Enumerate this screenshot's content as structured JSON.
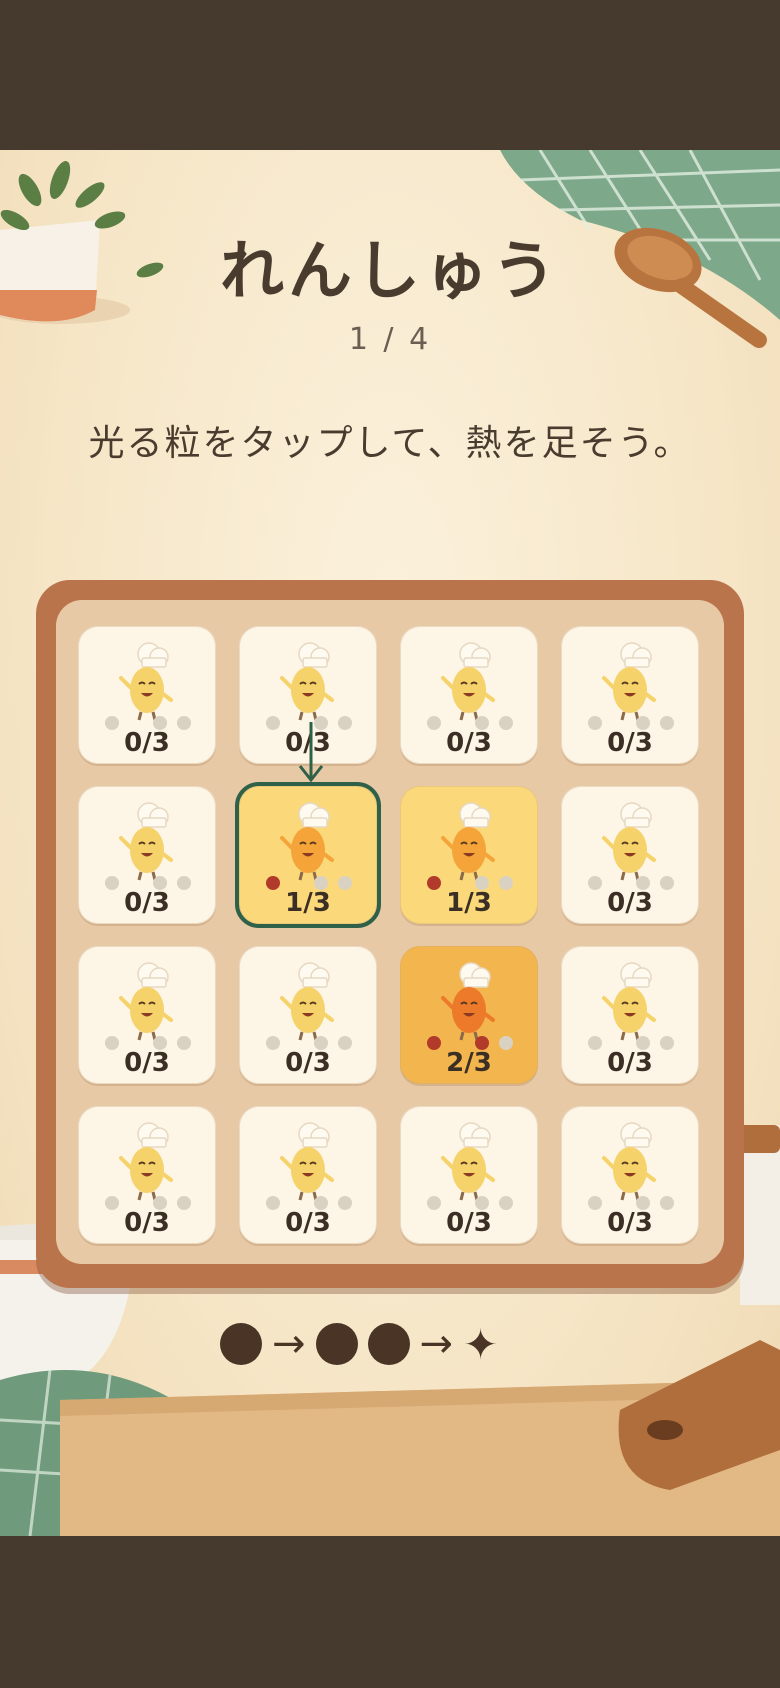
{
  "screen": {
    "title": "れんしゅう",
    "progress": "1 / 4",
    "instruction": "光る粒をタップして、熱を足そう。"
  },
  "grid": {
    "rows": 4,
    "cols": 4,
    "selected_index": 5,
    "tiles": [
      {
        "count": "0/3",
        "level": 0
      },
      {
        "count": "0/3",
        "level": 0
      },
      {
        "count": "0/3",
        "level": 0
      },
      {
        "count": "0/3",
        "level": 0
      },
      {
        "count": "0/3",
        "level": 0
      },
      {
        "count": "1/3",
        "level": 1
      },
      {
        "count": "1/3",
        "level": 1
      },
      {
        "count": "0/3",
        "level": 0
      },
      {
        "count": "0/3",
        "level": 0
      },
      {
        "count": "0/3",
        "level": 0
      },
      {
        "count": "2/3",
        "level": 2
      },
      {
        "count": "0/3",
        "level": 0
      },
      {
        "count": "0/3",
        "level": 0
      },
      {
        "count": "0/3",
        "level": 0
      },
      {
        "count": "0/3",
        "level": 0
      },
      {
        "count": "0/3",
        "level": 0
      }
    ]
  },
  "legend": {
    "items": [
      "dot",
      "arrow",
      "dot",
      "dot",
      "arrow",
      "sparkle"
    ],
    "arrow_glyph": "→",
    "sparkle_glyph": "✦"
  },
  "colors": {
    "frame": "#b9744b",
    "tray": "#e8c9a6",
    "tile_idle": "#fdf5e6",
    "tile_heat1": "#fbd97a",
    "tile_heat2": "#f3b54e",
    "selection": "#2f6048",
    "heat_dot": "#b23a2a"
  }
}
